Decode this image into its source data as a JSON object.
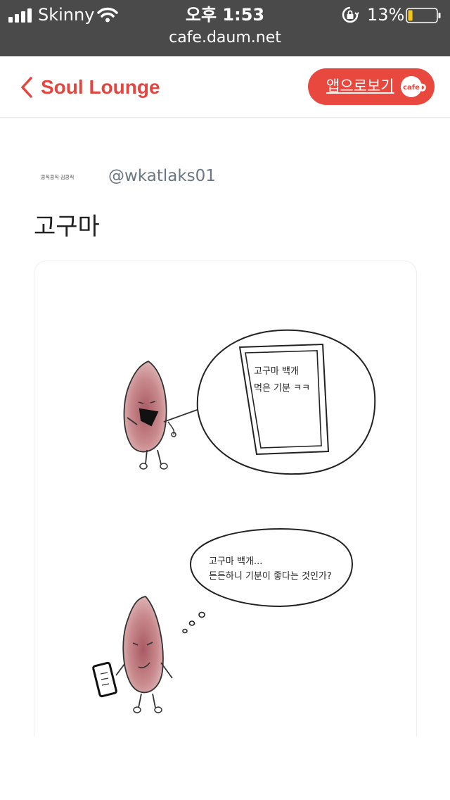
{
  "status_bar": {
    "carrier": "Skinny",
    "time": "오후 1:53",
    "battery_percent": "13%",
    "battery_level": 0.13,
    "url": "cafe.daum.net"
  },
  "header": {
    "title": "Soul Lounge",
    "app_button_label": "앱으로보기",
    "cafe_badge": "cafe"
  },
  "post": {
    "author_logo_text": "콩직콩직 김콩직",
    "author_handle": "@wkatlaks01",
    "title": "고구마"
  },
  "comic": {
    "panel1_line1": "고구마 백개",
    "panel1_line2": "먹은 기분 ㅋㅋ",
    "panel2_line1": "고구마 백개...",
    "panel2_line2": "든든하니 기분이 좋다는 것인가?"
  },
  "colors": {
    "accent": "#e2463f",
    "status_bar_bg": "#4a4a4a",
    "handle_gray": "#6b7683",
    "battery_fill": "#f5c518"
  },
  "icons": [
    "signal-icon",
    "wifi-icon",
    "orientation-lock-icon",
    "battery-icon",
    "back-chevron-icon",
    "cafe-badge-icon"
  ]
}
